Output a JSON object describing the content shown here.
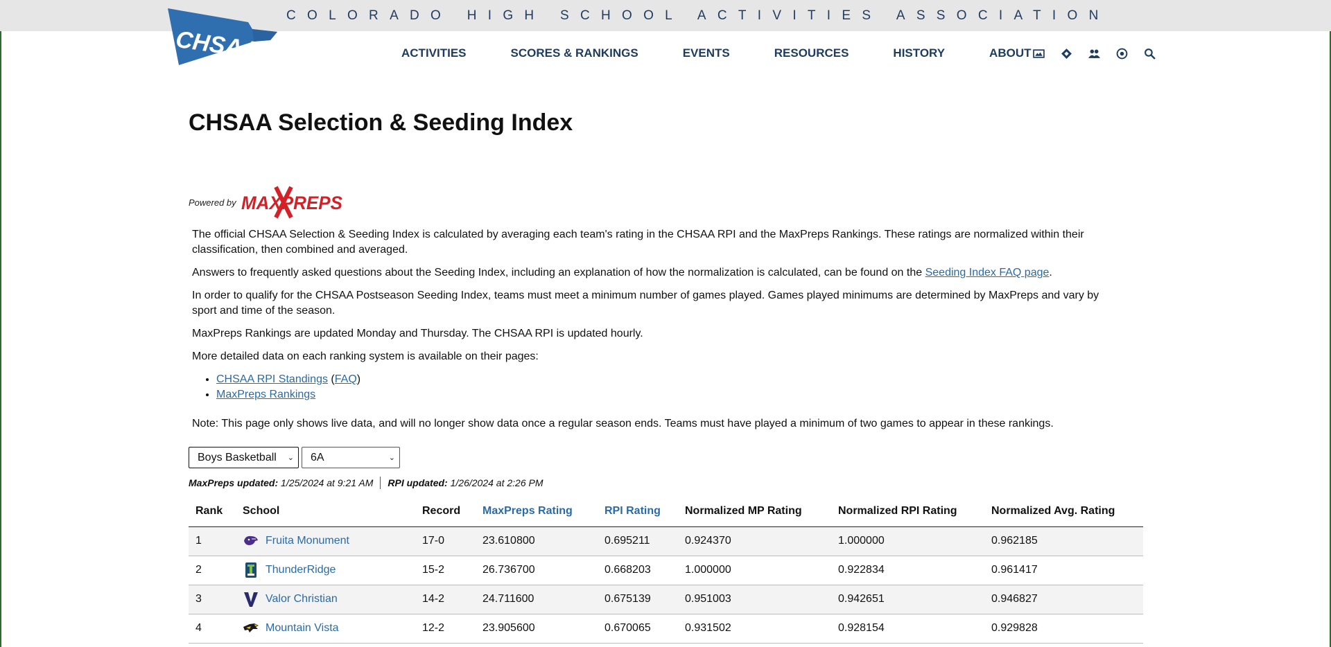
{
  "header": {
    "tagline": "COLORADO HIGH SCHOOL ACTIVITIES ASSOCIATION",
    "logo_text": "CHSAA",
    "nav": [
      "ACTIVITIES",
      "SCORES & RANKINGS",
      "EVENTS",
      "RESOURCES",
      "HISTORY",
      "ABOUT"
    ],
    "icons": [
      "image-icon",
      "ticket-icon",
      "users-icon",
      "target-icon",
      "search-icon"
    ]
  },
  "page": {
    "title": "CHSAA Selection & Seeding Index",
    "powered_by": "Powered by",
    "maxpreps_logo": "MAXPREPS",
    "p1": "The official CHSAA Selection & Seeding Index is calculated by averaging each team's rating in the CHSAA RPI and the MaxPreps Rankings. These ratings are normalized within their classification, then combined and averaged.",
    "p2_text": "Answers to frequently asked questions about the Seeding Index, including an explanation of how the normalization is calculated, can be found on the ",
    "p2_link": "Seeding Index FAQ page",
    "p2_end": ".",
    "p3": "In order to qualify for the CHSAA Postseason Seeding Index, teams must meet a minimum number of games played. Games played minimums are determined by MaxPreps and vary by sport and time of the season.",
    "p4": "MaxPreps Rankings are updated Monday and Thursday. The CHSAA RPI is updated hourly.",
    "p5": "More detailed data on each ranking system is available on their pages:",
    "link_rpi": "CHSAA RPI Standings",
    "link_faq": "FAQ",
    "link_maxpreps": "MaxPreps Rankings",
    "note": "Note: This page only shows live data, and will no longer show data once a regular season ends. Teams must have played a minimum of two games to appear in these rankings."
  },
  "filters": {
    "sport": "Boys Basketball",
    "classification": "6A"
  },
  "updates": {
    "maxpreps_label": "MaxPreps updated:",
    "maxpreps_value": "1/25/2024 at 9:21 AM",
    "rpi_label": "RPI updated:",
    "rpi_value": "1/26/2024 at 2:26 PM"
  },
  "table": {
    "headers": [
      "Rank",
      "School",
      "Record",
      "MaxPreps Rating",
      "RPI Rating",
      "Normalized MP Rating",
      "Normalized RPI Rating",
      "Normalized Avg. Rating"
    ],
    "rows": [
      {
        "rank": "1",
        "school": "Fruita Monument",
        "logo": "wildcat-logo-icon",
        "record": "17-0",
        "mp": "23.610800",
        "rpi": "0.695211",
        "nmp": "0.924370",
        "nrpi": "1.000000",
        "navg": "0.962185"
      },
      {
        "rank": "2",
        "school": "ThunderRidge",
        "logo": "grizzly-logo-icon",
        "record": "15-2",
        "mp": "26.736700",
        "rpi": "0.668203",
        "nmp": "1.000000",
        "nrpi": "0.922834",
        "navg": "0.961417"
      },
      {
        "rank": "3",
        "school": "Valor Christian",
        "logo": "v-letter-logo-icon",
        "record": "14-2",
        "mp": "24.711600",
        "rpi": "0.675139",
        "nmp": "0.951003",
        "nrpi": "0.942651",
        "navg": "0.946827"
      },
      {
        "rank": "4",
        "school": "Mountain Vista",
        "logo": "golden-eagle-logo-icon",
        "record": "12-2",
        "mp": "23.905600",
        "rpi": "0.670065",
        "nmp": "0.931502",
        "nrpi": "0.928154",
        "navg": "0.929828"
      }
    ]
  }
}
